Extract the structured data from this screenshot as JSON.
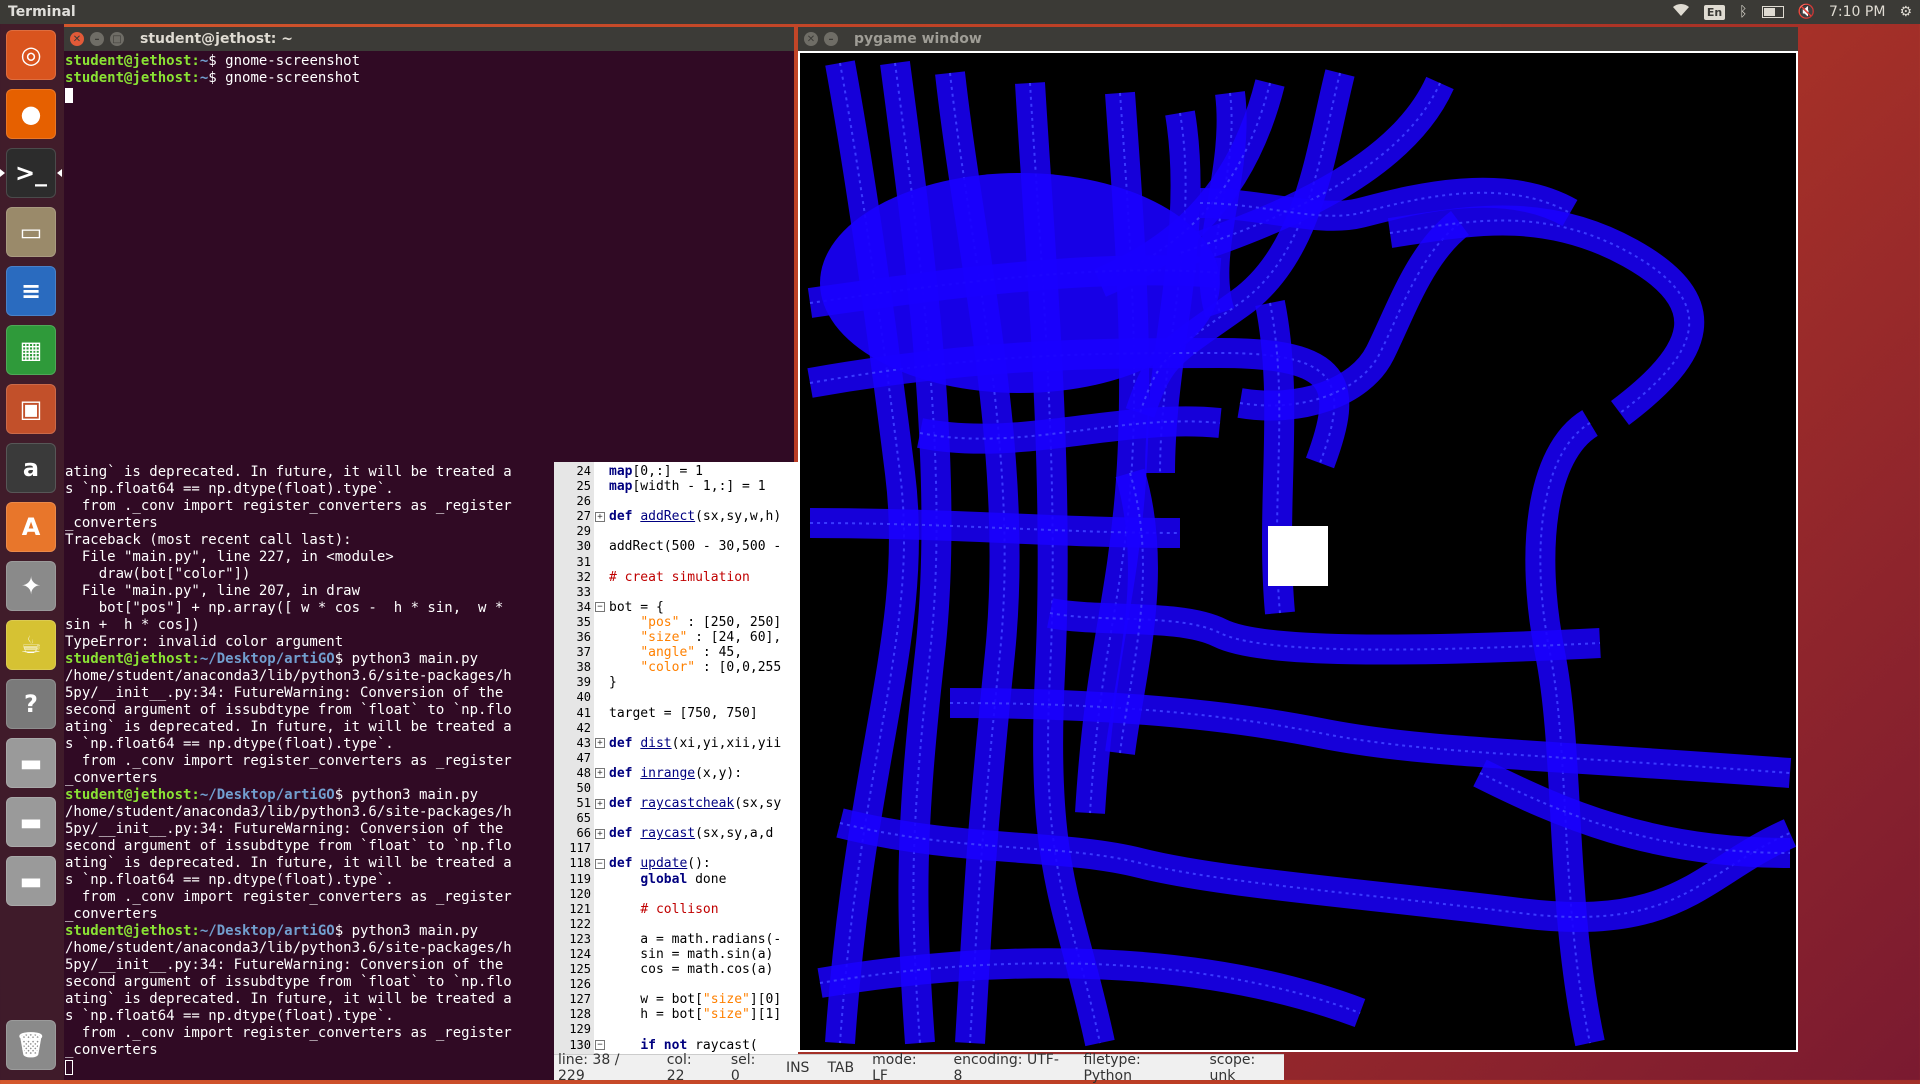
{
  "top_panel": {
    "app_title": "Terminal",
    "lang": "En",
    "time": "7:10 PM",
    "icons": [
      "wifi-icon",
      "keyboard-icon",
      "bluetooth-icon",
      "battery-icon",
      "volume-muted-icon",
      "settings-gear-icon"
    ]
  },
  "launcher": {
    "items": [
      {
        "name": "ubuntu-dash-icon",
        "glyph": "◎",
        "color": "#d9541e"
      },
      {
        "name": "firefox-icon",
        "glyph": "●",
        "color": "#e66000"
      },
      {
        "name": "terminal-icon",
        "glyph": ">_",
        "color": "#2c2c2c"
      },
      {
        "name": "files-icon",
        "glyph": "▭",
        "color": "#9a8a6a"
      },
      {
        "name": "writer-icon",
        "glyph": "≡",
        "color": "#2a6bbf"
      },
      {
        "name": "calc-icon",
        "glyph": "▦",
        "color": "#2f9a3a"
      },
      {
        "name": "impress-icon",
        "glyph": "▣",
        "color": "#c2502a"
      },
      {
        "name": "amazon-icon",
        "glyph": "a",
        "color": "#3a3a3a"
      },
      {
        "name": "software-center-icon",
        "glyph": "A",
        "color": "#e8762b"
      },
      {
        "name": "system-settings-icon",
        "glyph": "✦",
        "color": "#8a8a8a"
      },
      {
        "name": "tea-pot-icon",
        "glyph": "☕",
        "color": "#d6c233"
      },
      {
        "name": "help-icon",
        "glyph": "?",
        "color": "#7a7a7a"
      },
      {
        "name": "disk-1-icon",
        "glyph": "▬",
        "color": "#9a9a9a"
      },
      {
        "name": "disk-2-icon",
        "glyph": "▬",
        "color": "#9a9a9a"
      },
      {
        "name": "disk-3-icon",
        "glyph": "▬",
        "color": "#9a9a9a"
      },
      {
        "name": "trash-icon",
        "glyph": "🗑",
        "color": "#8a8a8a"
      }
    ]
  },
  "terminal_top": {
    "title": "student@jethost: ~",
    "lines": [
      {
        "user": "student@jethost",
        "path": "~",
        "cmd": " gnome-screenshot"
      },
      {
        "user": "student@jethost",
        "path": "~",
        "cmd": " gnome-screenshot"
      }
    ]
  },
  "terminal_bottom": {
    "lines": [
      "ating` is deprecated. In future, it will be treated a",
      "s `np.float64 == np.dtype(float).type`.",
      "  from ._conv import register_converters as _register",
      "_converters",
      "Traceback (most recent call last):",
      "  File \"main.py\", line 227, in <module>",
      "    draw(bot[\"color\"])",
      "  File \"main.py\", line 207, in draw",
      "    bot[\"pos\"] + np.array([ w * cos -  h * sin,  w *",
      "sin +  h * cos])",
      "TypeError: invalid color argument",
      {
        "user": "student@jethost",
        "path": "~/Desktop/artiGO",
        "cmd": " python3 main.py"
      },
      "/home/student/anaconda3/lib/python3.6/site-packages/h",
      "5py/__init__.py:34: FutureWarning: Conversion of the",
      "second argument of issubdtype from `float` to `np.flo",
      "ating` is deprecated. In future, it will be treated a",
      "s `np.float64 == np.dtype(float).type`.",
      "  from ._conv import register_converters as _register",
      "_converters",
      {
        "user": "student@jethost",
        "path": "~/Desktop/artiGO",
        "cmd": " python3 main.py"
      },
      "/home/student/anaconda3/lib/python3.6/site-packages/h",
      "5py/__init__.py:34: FutureWarning: Conversion of the",
      "second argument of issubdtype from `float` to `np.flo",
      "ating` is deprecated. In future, it will be treated a",
      "s `np.float64 == np.dtype(float).type`.",
      "  from ._conv import register_converters as _register",
      "_converters",
      {
        "user": "student@jethost",
        "path": "~/Desktop/artiGO",
        "cmd": " python3 main.py"
      },
      "/home/student/anaconda3/lib/python3.6/site-packages/h",
      "5py/__init__.py:34: FutureWarning: Conversion of the",
      "second argument of issubdtype from `float` to `np.flo",
      "ating` is deprecated. In future, it will be treated a",
      "s `np.float64 == np.dtype(float).type`.",
      "  from ._conv import register_converters as _register",
      "_converters"
    ]
  },
  "editor": {
    "lines": [
      {
        "n": "24",
        "fold": "",
        "parts": [
          [
            "map",
            "kw"
          ],
          [
            "[0,:] = 1",
            ""
          ]
        ]
      },
      {
        "n": "25",
        "fold": "",
        "parts": [
          [
            "map",
            "kw"
          ],
          [
            "[width - 1,:] = 1",
            ""
          ]
        ]
      },
      {
        "n": "26",
        "fold": "",
        "parts": []
      },
      {
        "n": "27",
        "fold": "⊞",
        "parts": [
          [
            "def ",
            "kw"
          ],
          [
            "addRect",
            "fn"
          ],
          [
            "(sx,sy,w,h)",
            ""
          ]
        ]
      },
      {
        "n": "29",
        "fold": "",
        "parts": []
      },
      {
        "n": "30",
        "fold": "",
        "parts": [
          [
            "addRect(500 - 30,500 -",
            ""
          ]
        ]
      },
      {
        "n": "31",
        "fold": "",
        "parts": []
      },
      {
        "n": "32",
        "fold": "",
        "parts": [
          [
            "# creat simulation",
            "cmt"
          ]
        ]
      },
      {
        "n": "33",
        "fold": "",
        "parts": []
      },
      {
        "n": "34",
        "fold": "⊟",
        "parts": [
          [
            "bot = {",
            ""
          ]
        ]
      },
      {
        "n": "35",
        "fold": "",
        "parts": [
          [
            "    ",
            ""
          ],
          [
            "\"pos\"",
            "str"
          ],
          [
            " : [250, 250]",
            ""
          ]
        ]
      },
      {
        "n": "36",
        "fold": "",
        "parts": [
          [
            "    ",
            ""
          ],
          [
            "\"size\"",
            "str"
          ],
          [
            " : [24, 60],",
            ""
          ]
        ]
      },
      {
        "n": "37",
        "fold": "",
        "parts": [
          [
            "    ",
            ""
          ],
          [
            "\"angle\"",
            "str"
          ],
          [
            " : 45,",
            ""
          ]
        ]
      },
      {
        "n": "38",
        "fold": "",
        "parts": [
          [
            "    ",
            ""
          ],
          [
            "\"color\"",
            "str"
          ],
          [
            " : [0,0,255",
            ""
          ]
        ]
      },
      {
        "n": "39",
        "fold": "",
        "parts": [
          [
            "}",
            ""
          ]
        ]
      },
      {
        "n": "40",
        "fold": "",
        "parts": []
      },
      {
        "n": "41",
        "fold": "",
        "parts": [
          [
            "target = [750, 750]",
            ""
          ]
        ]
      },
      {
        "n": "42",
        "fold": "",
        "parts": []
      },
      {
        "n": "43",
        "fold": "⊞",
        "parts": [
          [
            "def ",
            "kw"
          ],
          [
            "dist",
            "fn"
          ],
          [
            "(xi,yi,xii,yii",
            ""
          ]
        ]
      },
      {
        "n": "47",
        "fold": "",
        "parts": []
      },
      {
        "n": "48",
        "fold": "⊞",
        "parts": [
          [
            "def ",
            "kw"
          ],
          [
            "inrange",
            "fn"
          ],
          [
            "(x,y):",
            ""
          ]
        ]
      },
      {
        "n": "50",
        "fold": "",
        "parts": []
      },
      {
        "n": "51",
        "fold": "⊞",
        "parts": [
          [
            "def ",
            "kw"
          ],
          [
            "raycastcheak",
            "fn"
          ],
          [
            "(sx,sy",
            ""
          ]
        ]
      },
      {
        "n": "65",
        "fold": "",
        "parts": []
      },
      {
        "n": "66",
        "fold": "⊞",
        "parts": [
          [
            "def ",
            "kw"
          ],
          [
            "raycast",
            "fn"
          ],
          [
            "(sx,sy,a,d",
            ""
          ]
        ]
      },
      {
        "n": "117",
        "fold": "",
        "parts": []
      },
      {
        "n": "118",
        "fold": "⊟",
        "parts": [
          [
            "def ",
            "kw"
          ],
          [
            "update",
            "fn"
          ],
          [
            "():",
            ""
          ]
        ]
      },
      {
        "n": "119",
        "fold": "",
        "parts": [
          [
            "    ",
            ""
          ],
          [
            "global",
            "kw"
          ],
          [
            " done",
            ""
          ]
        ]
      },
      {
        "n": "120",
        "fold": "",
        "parts": []
      },
      {
        "n": "121",
        "fold": "",
        "parts": [
          [
            "    ",
            ""
          ],
          [
            "# collison",
            "cmt"
          ]
        ]
      },
      {
        "n": "122",
        "fold": "",
        "parts": []
      },
      {
        "n": "123",
        "fold": "",
        "parts": [
          [
            "    a = math.radians(-",
            ""
          ]
        ]
      },
      {
        "n": "124",
        "fold": "",
        "parts": [
          [
            "    sin = math.sin(a)",
            ""
          ]
        ]
      },
      {
        "n": "125",
        "fold": "",
        "parts": [
          [
            "    cos = math.cos(a)",
            ""
          ]
        ]
      },
      {
        "n": "126",
        "fold": "",
        "parts": []
      },
      {
        "n": "127",
        "fold": "",
        "parts": [
          [
            "    w = bot[",
            ""
          ],
          [
            "\"size\"",
            "str"
          ],
          [
            "][0]",
            ""
          ]
        ]
      },
      {
        "n": "128",
        "fold": "",
        "parts": [
          [
            "    h = bot[",
            ""
          ],
          [
            "\"size\"",
            "str"
          ],
          [
            "][1]",
            ""
          ]
        ]
      },
      {
        "n": "129",
        "fold": "",
        "parts": []
      },
      {
        "n": "130",
        "fold": "⊟",
        "parts": [
          [
            "    ",
            ""
          ],
          [
            "if not",
            "kw"
          ],
          [
            " raycast(",
            ""
          ]
        ]
      }
    ],
    "status": {
      "line": "line: 38 / 229",
      "col": "col: 22",
      "sel": "sel: 0",
      "ins": "INS",
      "tab": "TAB",
      "mode": "mode: LF",
      "encoding": "encoding: UTF-8",
      "filetype": "filetype: Python",
      "scope": "scope: unk"
    }
  },
  "pygame": {
    "title": "pygame window",
    "trail_color": "#1a00ff",
    "obstacle_color": "#ffffff"
  }
}
